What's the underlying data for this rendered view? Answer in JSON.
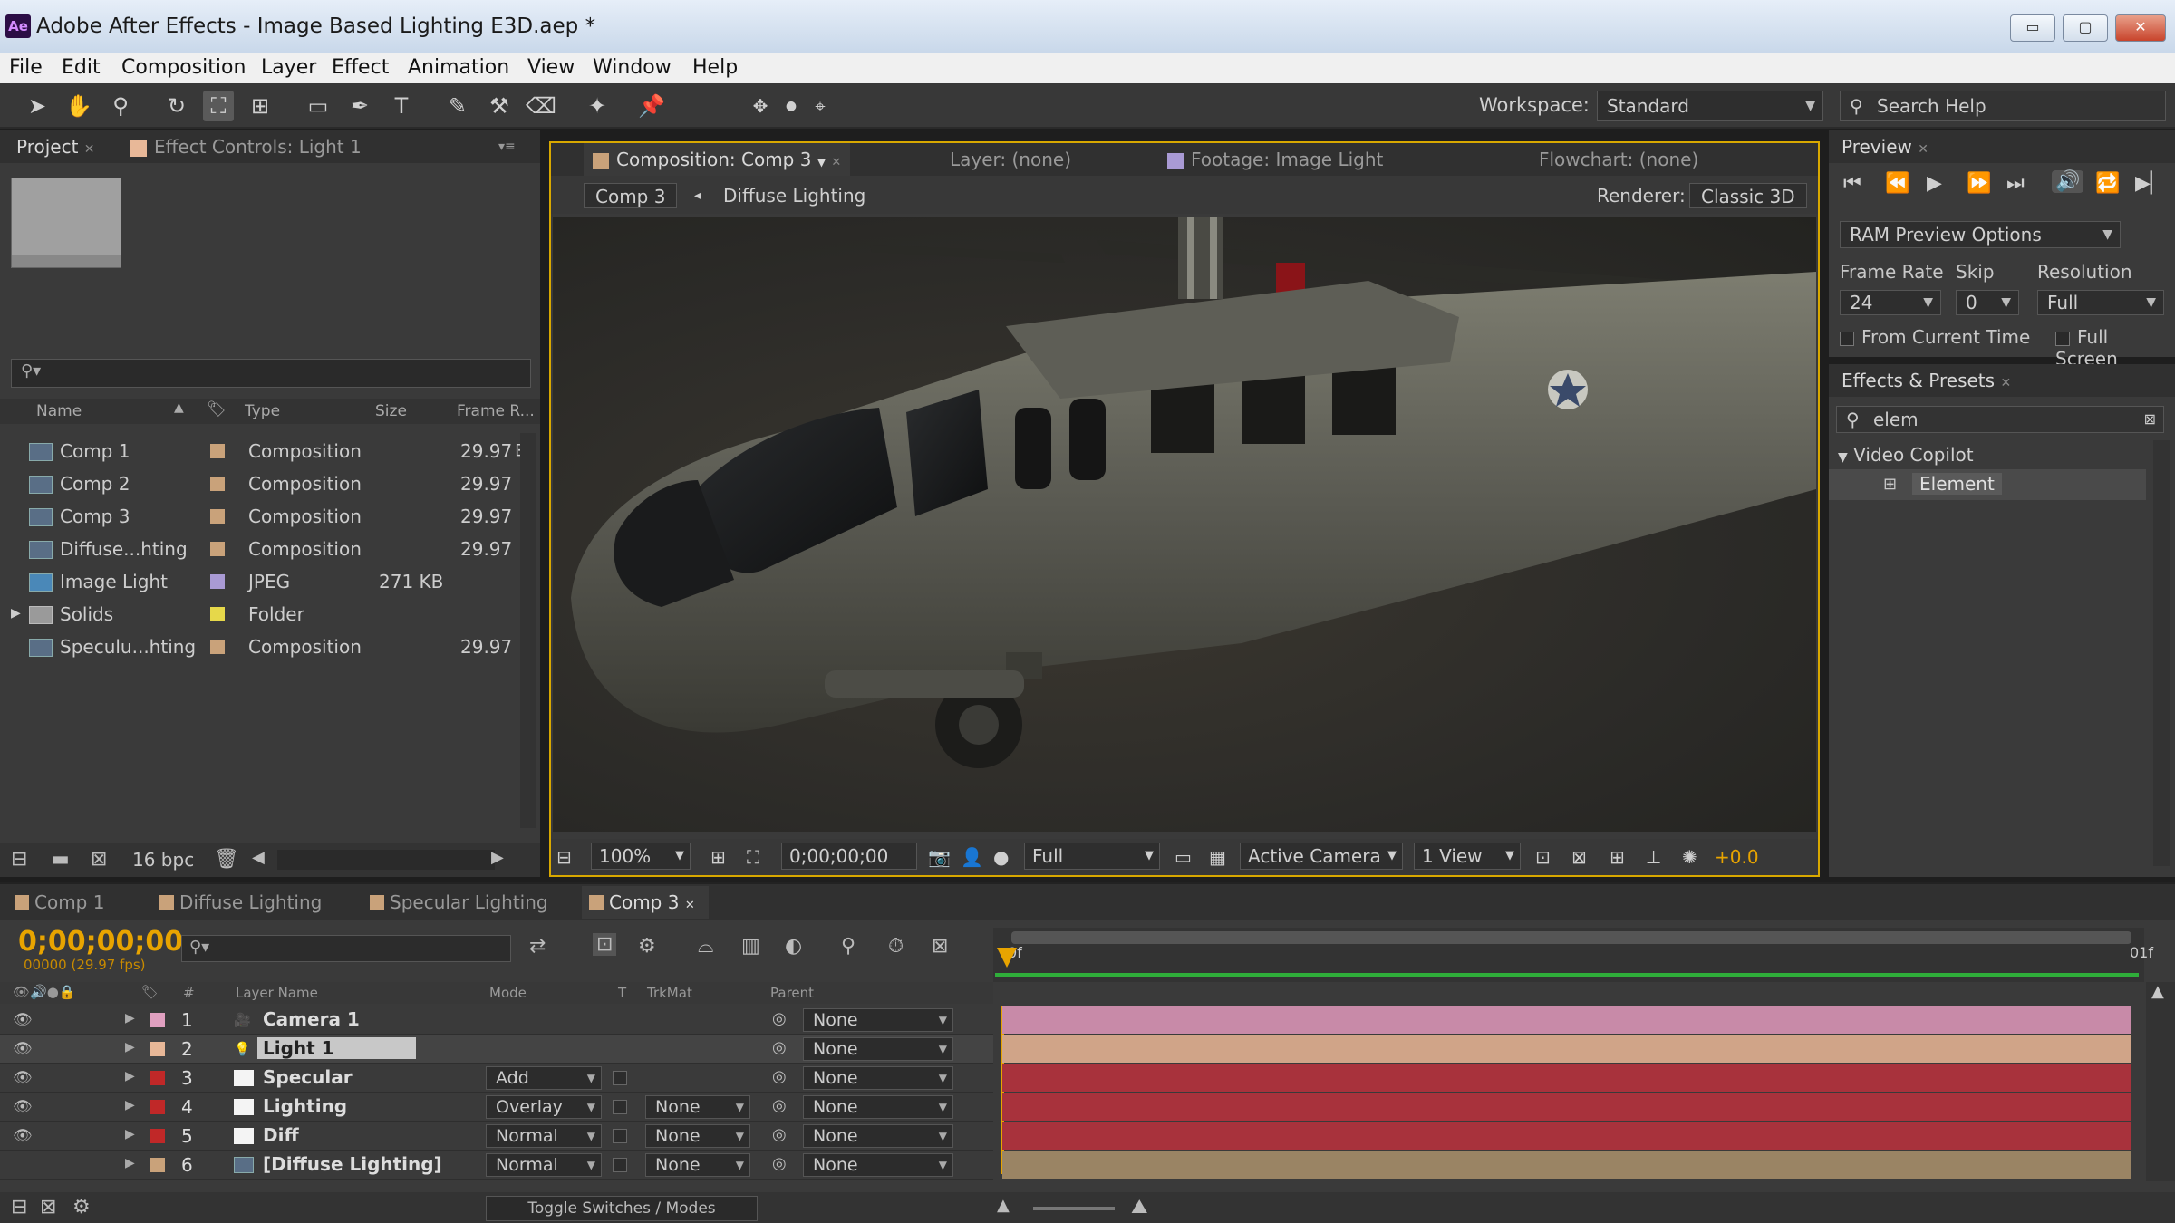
{
  "window": {
    "app_icon": "Ae",
    "title": "Adobe After Effects - Image Based Lighting E3D.aep *",
    "min_label": "▭",
    "max_label": "▢",
    "close_label": "✕"
  },
  "menu": [
    "File",
    "Edit",
    "Composition",
    "Layer",
    "Effect",
    "Animation",
    "View",
    "Window",
    "Help"
  ],
  "toolbar": {
    "workspace_label": "Workspace:",
    "workspace_value": "Standard",
    "search_placeholder": "Search Help"
  },
  "project_panel": {
    "tab_project": "Project",
    "tab_effect_controls": "Effect Controls: Light 1",
    "columns": {
      "name": "Name",
      "type": "Type",
      "size": "Size",
      "frame_rate": "Frame R..."
    },
    "items": [
      {
        "name": "Comp 1",
        "type": "Composition",
        "size": "",
        "frame_rate": "29.97",
        "label_color": "#c9a27a",
        "icon": "composition-icon"
      },
      {
        "name": "Comp 2",
        "type": "Composition",
        "size": "",
        "frame_rate": "29.97",
        "label_color": "#c9a27a",
        "icon": "composition-icon"
      },
      {
        "name": "Comp 3",
        "type": "Composition",
        "size": "",
        "frame_rate": "29.97",
        "label_color": "#c9a27a",
        "icon": "composition-icon"
      },
      {
        "name": "Diffuse...hting",
        "type": "Composition",
        "size": "",
        "frame_rate": "29.97",
        "label_color": "#c9a27a",
        "icon": "composition-icon"
      },
      {
        "name": "Image Light",
        "type": "JPEG",
        "size": "271 KB",
        "frame_rate": "",
        "label_color": "#a99ad4",
        "icon": "image-icon"
      },
      {
        "name": "Solids",
        "type": "Folder",
        "size": "",
        "frame_rate": "",
        "label_color": "#e6d84a",
        "icon": "folder-icon"
      },
      {
        "name": "Speculu...hting",
        "type": "Composition",
        "size": "",
        "frame_rate": "29.97",
        "label_color": "#c9a27a",
        "icon": "composition-icon"
      }
    ],
    "bpc_label": "16 bpc"
  },
  "viewer": {
    "tab_composition": "Composition: Comp 3",
    "tab_layer": "Layer: (none)",
    "tab_footage": "Footage: Image Light",
    "tab_flowchart": "Flowchart: (none)",
    "crumb_active": "Comp 3",
    "crumb_next": "Diffuse Lighting",
    "renderer_label": "Renderer:",
    "renderer_value": "Classic 3D",
    "zoom": "100%",
    "timecode": "0;00;00;00",
    "resolution": "Full",
    "camera": "Active Camera",
    "views": "1 View",
    "exposure": "+0.0"
  },
  "preview_panel": {
    "tab": "Preview",
    "ram_options": "RAM Preview Options",
    "frame_rate_label": "Frame Rate",
    "skip_label": "Skip",
    "resolution_label": "Resolution",
    "frame_rate_value": "24",
    "skip_value": "0",
    "resolution_value": "Full",
    "from_current_time": "From Current Time",
    "full_screen": "Full Screen"
  },
  "effects_panel": {
    "tab": "Effects & Presets",
    "search_value": "elem",
    "category": "Video Copilot",
    "item": "Element"
  },
  "timeline": {
    "tabs": [
      {
        "label": "Comp 1",
        "color": "#c9a27a"
      },
      {
        "label": "Diffuse Lighting",
        "color": "#c9a27a"
      },
      {
        "label": "Specular Lighting",
        "color": "#c9a27a"
      },
      {
        "label": "Comp 3",
        "color": "#c9a27a"
      }
    ],
    "timecode": "0;00;00;00",
    "fps": "00000 (29.97 fps)",
    "columns": {
      "hash": "#",
      "layer_name": "Layer Name",
      "mode": "Mode",
      "t": "T",
      "trkmat": "TrkMat",
      "parent": "Parent"
    },
    "ruler_start": "0f",
    "ruler_end": "01f",
    "layers": [
      {
        "num": "1",
        "name": "Camera 1",
        "mode": "",
        "trkmat": "",
        "parent": "None",
        "label_color": "#e0a0c0",
        "bar_color": "#c88aa8",
        "icon": "camera-icon"
      },
      {
        "num": "2",
        "name": "Light 1",
        "mode": "",
        "trkmat": "",
        "parent": "None",
        "label_color": "#e8b898",
        "bar_color": "#d0a488",
        "icon": "light-icon"
      },
      {
        "num": "3",
        "name": "Specular",
        "mode": "Add",
        "trkmat": "",
        "parent": "None",
        "label_color": "#c02828",
        "bar_color": "#a8323c",
        "icon": "solid-icon"
      },
      {
        "num": "4",
        "name": "Lighting",
        "mode": "Overlay",
        "trkmat": "None",
        "parent": "None",
        "label_color": "#c02828",
        "bar_color": "#a8323c",
        "icon": "solid-icon"
      },
      {
        "num": "5",
        "name": "Diff",
        "mode": "Normal",
        "trkmat": "None",
        "parent": "None",
        "label_color": "#c02828",
        "bar_color": "#a8323c",
        "icon": "solid-icon"
      },
      {
        "num": "6",
        "name": "[Diffuse Lighting]",
        "mode": "Normal",
        "trkmat": "None",
        "parent": "None",
        "label_color": "#c9a27a",
        "bar_color": "#9a8464",
        "icon": "composition-icon"
      }
    ],
    "toggle_label": "Toggle Switches / Modes"
  }
}
